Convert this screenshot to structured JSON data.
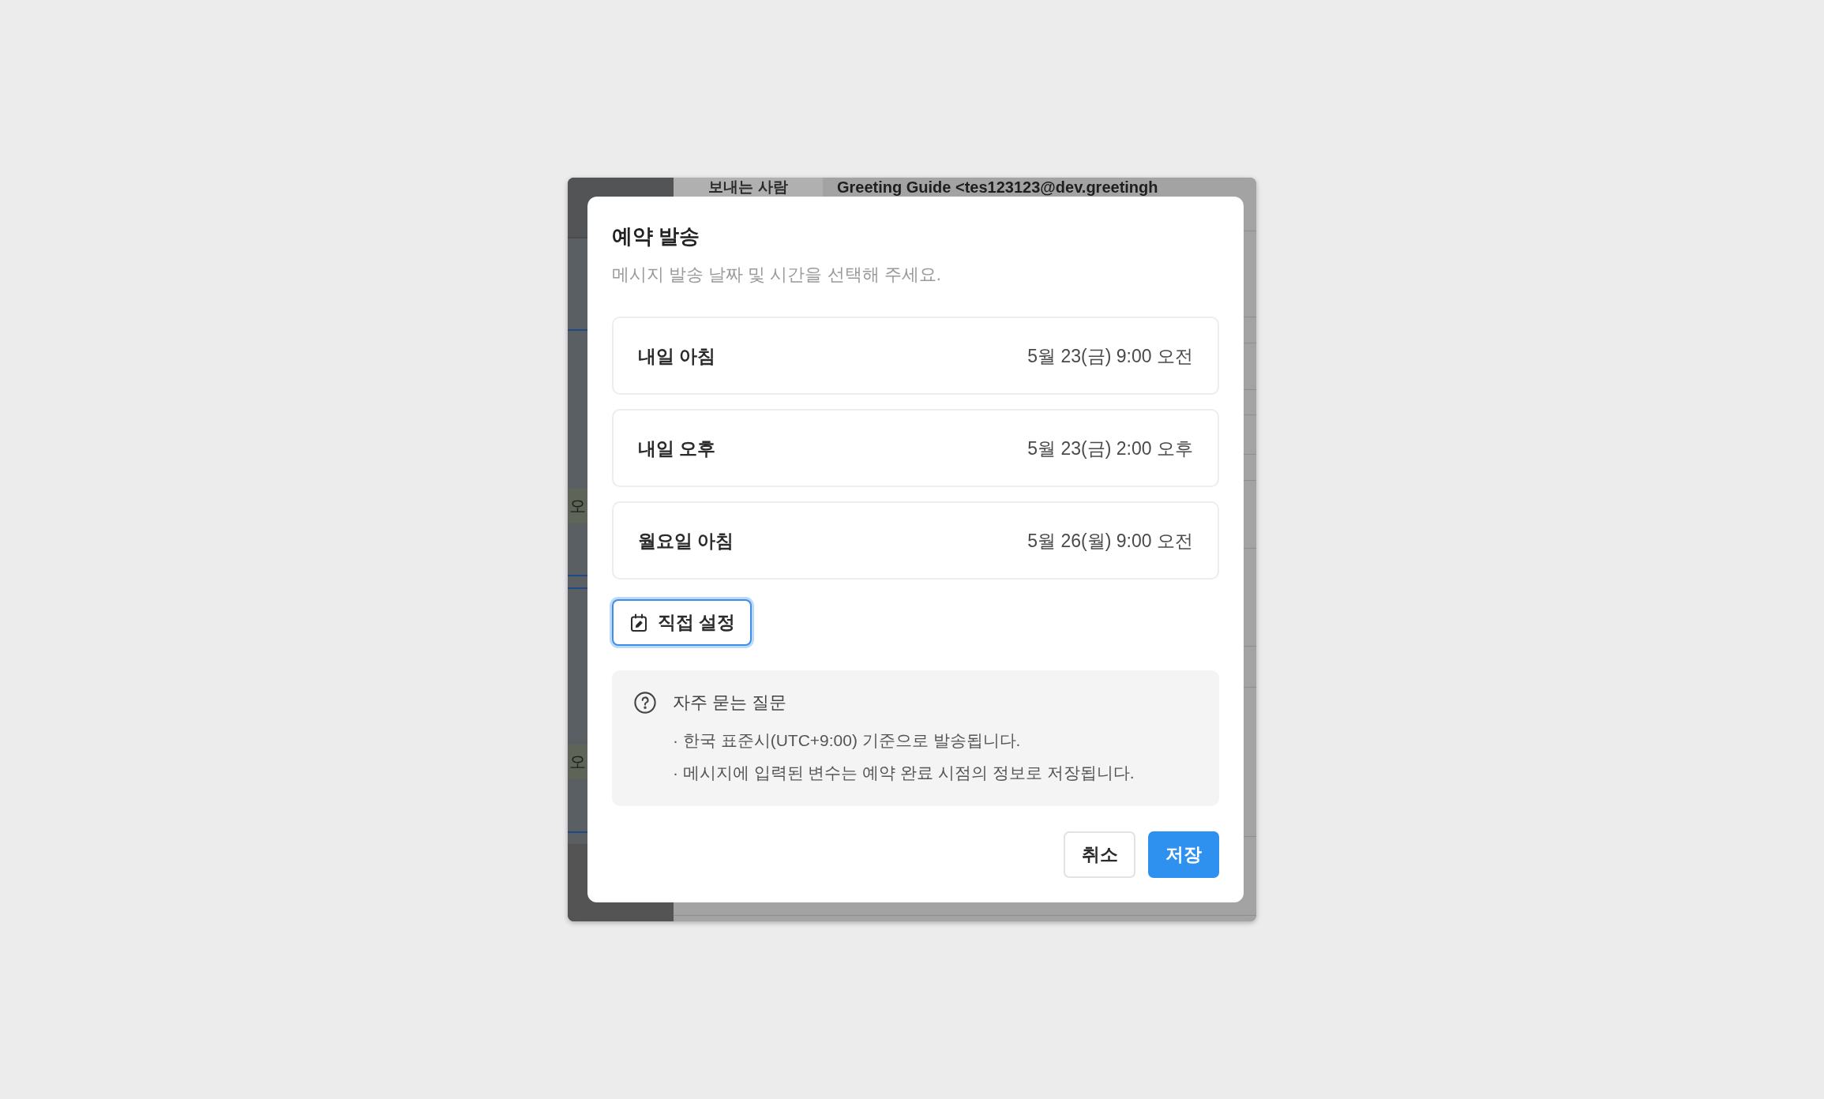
{
  "background": {
    "sender_label": "보내는 사람",
    "sender_value": "Greeting Guide <tes123123@dev.greetingh",
    "side_cells": [
      "오",
      "오"
    ]
  },
  "dialog": {
    "title": "예약 발송",
    "subtitle": "메시지 발송 날짜 및 시간을 선택해 주세요.",
    "options": [
      {
        "label": "내일 아침",
        "datetime": "5월 23(금) 9:00 오전",
        "selected": false
      },
      {
        "label": "내일 오후",
        "datetime": "5월 23(금) 2:00 오후",
        "selected": false
      },
      {
        "label": "월요일 아침",
        "datetime": "5월 26(월) 9:00 오전",
        "selected": false
      }
    ],
    "custom_button": {
      "label": "직접 설정",
      "focused": true
    },
    "faq": {
      "title": "자주 묻는 질문",
      "items": [
        "· 한국 표준시(UTC+9:00) 기준으로 발송됩니다.",
        "· 메시지에 입력된 변수는 예약 완료 시점의 정보로 저장됩니다."
      ]
    },
    "buttons": [
      {
        "label": "취소",
        "kind": "secondary"
      },
      {
        "label": "저장",
        "kind": "primary"
      }
    ]
  }
}
